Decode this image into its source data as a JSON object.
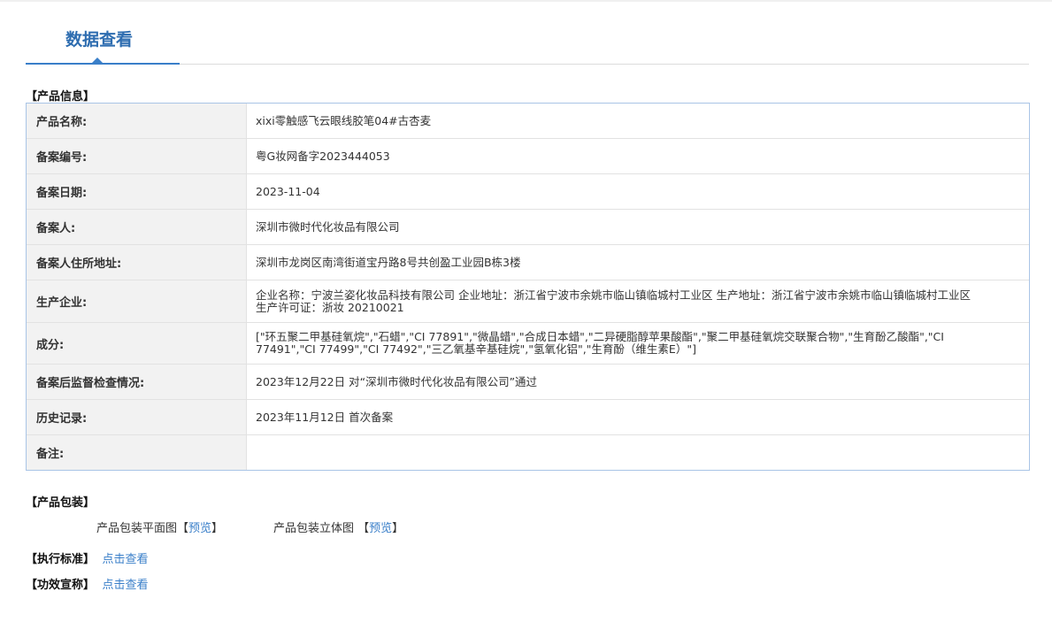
{
  "header": {
    "tab_label": "数据查看"
  },
  "product_info": {
    "section_title": "【产品信息】",
    "rows": [
      {
        "label": "产品名称:",
        "value": "xixi零触感飞云眼线胶笔04#古杏麦"
      },
      {
        "label": "备案编号:",
        "value": "粤G妆网备字2023444053"
      },
      {
        "label": "备案日期:",
        "value": "2023-11-04"
      },
      {
        "label": "备案人:",
        "value": "深圳市微时代化妆品有限公司"
      },
      {
        "label": "备案人住所地址:",
        "value": "深圳市龙岗区南湾街道宝丹路8号共创盈工业园B栋3楼"
      },
      {
        "label": "生产企业:",
        "value": "企业名称：宁波兰姿化妆品科技有限公司 企业地址：浙江省宁波市余姚市临山镇临城村工业区 生产地址：浙江省宁波市余姚市临山镇临城村工业区 生产许可证：浙妆 20210021"
      },
      {
        "label": "成分:",
        "value": "[\"环五聚二甲基硅氧烷\",\"石蜡\",\"CI 77891\",\"微晶蜡\",\"合成日本蜡\",\"二异硬脂醇苹果酸酯\",\"聚二甲基硅氧烷交联聚合物\",\"生育酚乙酸酯\",\"CI 77491\",\"CI 77499\",\"CI 77492\",\"三乙氧基辛基硅烷\",\"氢氧化铝\",\"生育酚（维生素E）\"]"
      },
      {
        "label": "备案后监督检查情况:",
        "value": "2023年12月22日 对“深圳市微时代化妆品有限公司”通过"
      },
      {
        "label": "历史记录:",
        "value": "2023年11月12日 首次备案"
      },
      {
        "label": "备注:",
        "value": ""
      }
    ]
  },
  "packaging": {
    "section_title": "【产品包装】",
    "flat_label": "产品包装平面图",
    "flat_link": "预览",
    "solid_label": "产品包装立体图",
    "solid_link": "预览"
  },
  "standard": {
    "section_title": "【执行标准】",
    "link": "点击查看"
  },
  "efficacy": {
    "section_title": "【功效宣称】",
    "link": "点击查看"
  }
}
